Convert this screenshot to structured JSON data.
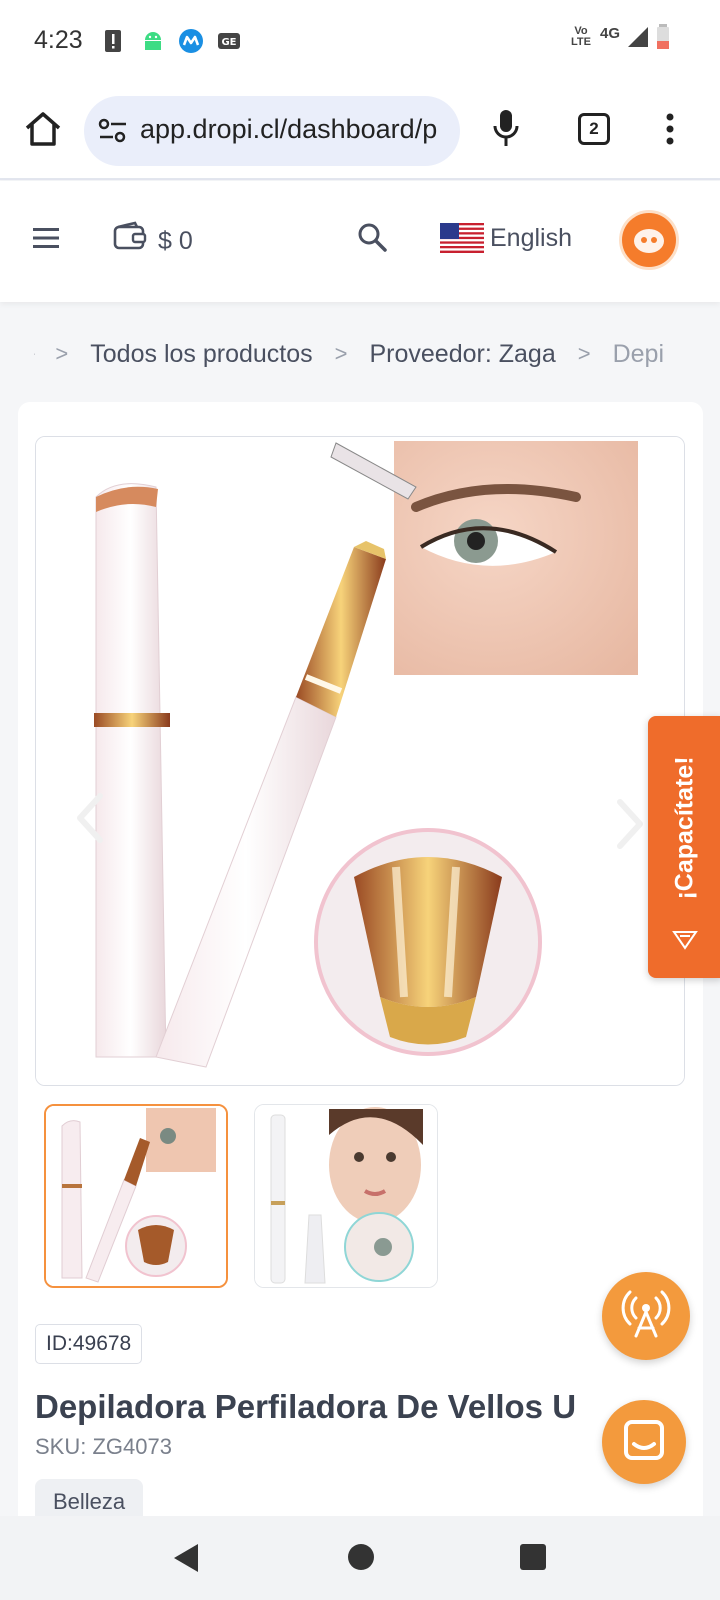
{
  "status_bar": {
    "time": "4:23",
    "network": "4G",
    "volte": "Vo LTE"
  },
  "browser": {
    "url": "app.dropi.cl/dashboard/p",
    "tab_count": "2"
  },
  "header": {
    "wallet_amount": "$ 0",
    "language": "English"
  },
  "breadcrumb": {
    "items": [
      "Todos los productos",
      "Proveedor: Zaga",
      "Depi"
    ]
  },
  "product": {
    "id_label": "ID:49678",
    "title": "Depiladora Perfiladora De Vellos U",
    "sku": "SKU: ZG4073",
    "category": "Belleza"
  },
  "floating": {
    "capacitate_label": "¡Capacítate!"
  },
  "colors": {
    "accent": "#F39A3D",
    "capacitate": "#EF6C2B",
    "text": "#3B4250"
  }
}
